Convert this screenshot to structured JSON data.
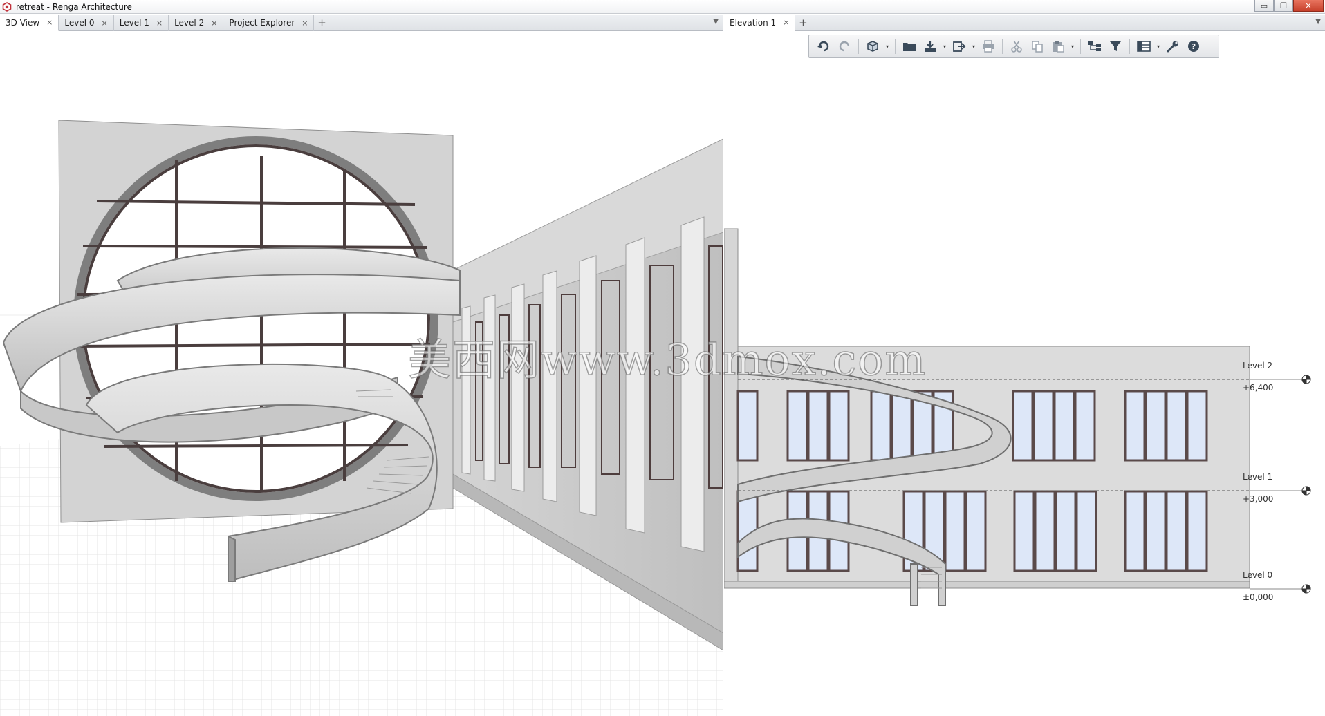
{
  "window": {
    "title": "retreat - Renga Architecture",
    "controls": {
      "minimize": "▭",
      "restore": "❐",
      "close": "✕"
    }
  },
  "left_pane": {
    "tabs": [
      {
        "label": "3D View",
        "active": true
      },
      {
        "label": "Level 0"
      },
      {
        "label": "Level 1"
      },
      {
        "label": "Level 2"
      },
      {
        "label": "Project Explorer"
      }
    ],
    "tab_close": "×",
    "add_tab": "+",
    "tab_menu": "▼"
  },
  "right_pane": {
    "tabs": [
      {
        "label": "Elevation 1",
        "active": true
      }
    ],
    "tab_close": "×",
    "add_tab": "+",
    "tab_menu": "▼",
    "toolbar": {
      "buttons": [
        "undo-icon",
        "redo-icon",
        "view-cube-icon",
        "open-icon",
        "save-icon",
        "export-icon",
        "print-icon",
        "cut-icon",
        "copy-icon",
        "paste-icon",
        "hierarchy-icon",
        "filter-icon",
        "table-icon",
        "wrench-icon",
        "help-icon"
      ],
      "dropdown": "▾"
    },
    "levels": [
      {
        "name": "Level 2",
        "elevation": "+6,400"
      },
      {
        "name": "Level 1",
        "elevation": "+3,000"
      },
      {
        "name": "Level 0",
        "elevation": "±0,000"
      }
    ]
  },
  "watermark": "美西网www.3dmox.com",
  "colors": {
    "window_glass": "#dde7f8",
    "wall": "#dcdcdc",
    "frame": "#5a4a4a",
    "close_btn": "#c7402b"
  }
}
